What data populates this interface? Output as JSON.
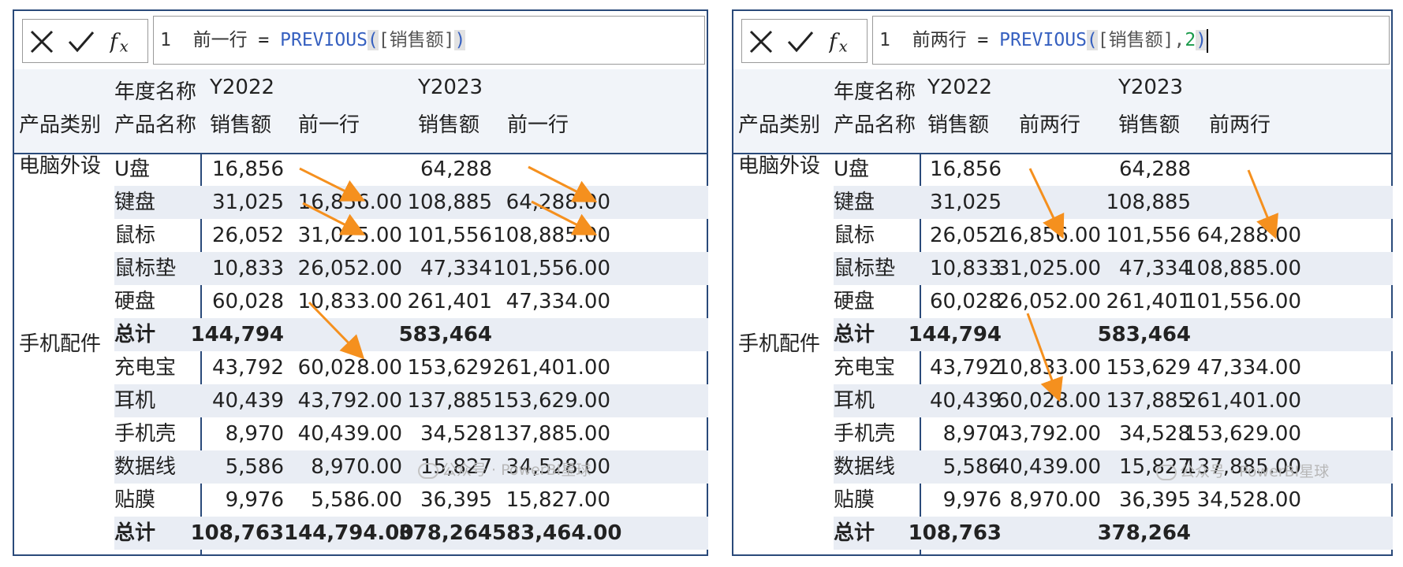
{
  "left_panel": {
    "formula": {
      "line": "1",
      "measure": "前一行",
      "eq": "=",
      "fn": "PREVIOUS",
      "open": "(",
      "column": "[销售额]",
      "sep": "",
      "arg": "",
      "close": ")"
    },
    "header": {
      "year_label": "年度名称",
      "category_label": "产品类别",
      "product_label": "产品名称",
      "years": [
        "Y2022",
        "Y2023"
      ],
      "sales": "销售额",
      "prev": "前一行"
    },
    "categories": [
      "电脑外设",
      "手机配件"
    ],
    "rows": [
      {
        "product": "U盘",
        "s22": "16,856",
        "p22": "",
        "s23": "64,288",
        "p23": ""
      },
      {
        "product": "键盘",
        "s22": "31,025",
        "p22": "16,856.00",
        "s23": "108,885",
        "p23": "64,288.00"
      },
      {
        "product": "鼠标",
        "s22": "26,052",
        "p22": "31,025.00",
        "s23": "101,556",
        "p23": "108,885.00"
      },
      {
        "product": "鼠标垫",
        "s22": "10,833",
        "p22": "26,052.00",
        "s23": "47,334",
        "p23": "101,556.00"
      },
      {
        "product": "硬盘",
        "s22": "60,028",
        "p22": "10,833.00",
        "s23": "261,401",
        "p23": "47,334.00"
      },
      {
        "product": "总计",
        "s22": "144,794",
        "p22": "",
        "s23": "583,464",
        "p23": ""
      },
      {
        "product": "充电宝",
        "s22": "43,792",
        "p22": "60,028.00",
        "s23": "153,629",
        "p23": "261,401.00"
      },
      {
        "product": "耳机",
        "s22": "40,439",
        "p22": "43,792.00",
        "s23": "137,885",
        "p23": "153,629.00"
      },
      {
        "product": "手机壳",
        "s22": "8,970",
        "p22": "40,439.00",
        "s23": "34,528",
        "p23": "137,885.00"
      },
      {
        "product": "数据线",
        "s22": "5,586",
        "p22": "8,970.00",
        "s23": "15,827",
        "p23": "34,528.00"
      },
      {
        "product": "贴膜",
        "s22": "9,976",
        "p22": "5,586.00",
        "s23": "36,395",
        "p23": "15,827.00"
      },
      {
        "product": "总计",
        "s22": "108,763",
        "p22": "144,794.00",
        "s23": "378,264",
        "p23": "583,464.00"
      }
    ],
    "watermark": "公众号 · PowerBI星球"
  },
  "right_panel": {
    "formula": {
      "line": "1",
      "measure": "前两行",
      "eq": "=",
      "fn": "PREVIOUS",
      "open": "(",
      "column": "[销售额]",
      "sep": ",",
      "arg": "2",
      "close": ")"
    },
    "header": {
      "year_label": "年度名称",
      "category_label": "产品类别",
      "product_label": "产品名称",
      "years": [
        "Y2022",
        "Y2023"
      ],
      "sales": "销售额",
      "prev": "前两行"
    },
    "categories": [
      "电脑外设",
      "手机配件"
    ],
    "rows": [
      {
        "product": "U盘",
        "s22": "16,856",
        "p22": "",
        "s23": "64,288",
        "p23": ""
      },
      {
        "product": "键盘",
        "s22": "31,025",
        "p22": "",
        "s23": "108,885",
        "p23": ""
      },
      {
        "product": "鼠标",
        "s22": "26,052",
        "p22": "16,856.00",
        "s23": "101,556",
        "p23": "64,288.00"
      },
      {
        "product": "鼠标垫",
        "s22": "10,833",
        "p22": "31,025.00",
        "s23": "47,334",
        "p23": "108,885.00"
      },
      {
        "product": "硬盘",
        "s22": "60,028",
        "p22": "26,052.00",
        "s23": "261,401",
        "p23": "101,556.00"
      },
      {
        "product": "总计",
        "s22": "144,794",
        "p22": "",
        "s23": "583,464",
        "p23": ""
      },
      {
        "product": "充电宝",
        "s22": "43,792",
        "p22": "10,833.00",
        "s23": "153,629",
        "p23": "47,334.00"
      },
      {
        "product": "耳机",
        "s22": "40,439",
        "p22": "60,028.00",
        "s23": "137,885",
        "p23": "261,401.00"
      },
      {
        "product": "手机壳",
        "s22": "8,970",
        "p22": "43,792.00",
        "s23": "34,528",
        "p23": "153,629.00"
      },
      {
        "product": "数据线",
        "s22": "5,586",
        "p22": "40,439.00",
        "s23": "15,827",
        "p23": "137,885.00"
      },
      {
        "product": "贴膜",
        "s22": "9,976",
        "p22": "8,970.00",
        "s23": "36,395",
        "p23": "34,528.00"
      },
      {
        "product": "总计",
        "s22": "108,763",
        "p22": "",
        "s23": "378,264",
        "p23": ""
      }
    ],
    "watermark": "公众号 · PowerBI星球"
  },
  "colors": {
    "border": "#2a4a7a",
    "header_bg": "#f1f4f9",
    "stripe": "#e9edf4",
    "arrow": "#f5901e",
    "function": "#3660c0",
    "literal": "#1a9a4a"
  },
  "icons": [
    "close-icon",
    "check-icon",
    "fx-icon"
  ]
}
